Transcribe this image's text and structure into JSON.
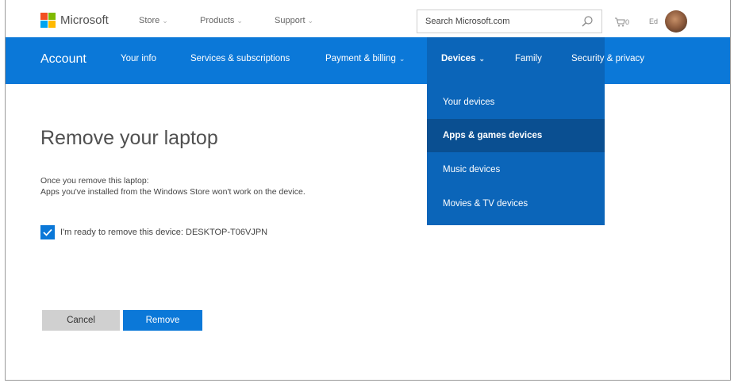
{
  "header": {
    "brand": "Microsoft",
    "nav": [
      {
        "label": "Store",
        "chevron": "⌄"
      },
      {
        "label": "Products",
        "chevron": "⌄"
      },
      {
        "label": "Support",
        "chevron": "⌄"
      }
    ],
    "search": {
      "placeholder": "Search Microsoft.com",
      "icon": "search-icon"
    },
    "cart": {
      "count": "0",
      "icon": "cart-icon"
    },
    "user_initials": "Ed"
  },
  "account_nav": {
    "account_label": "Account",
    "items": [
      {
        "label": "Your info"
      },
      {
        "label": "Services & subscriptions"
      },
      {
        "label": "Payment & billing",
        "chevron": "⌄"
      },
      {
        "label": "Devices",
        "chevron": "⌄",
        "active": true
      },
      {
        "label": "Family"
      },
      {
        "label": "Security & privacy"
      }
    ]
  },
  "devices_menu": {
    "items": [
      {
        "label": "Your devices"
      },
      {
        "label": "Apps & games devices",
        "highlighted": true
      },
      {
        "label": "Music devices"
      },
      {
        "label": "Movies & TV devices"
      }
    ]
  },
  "main": {
    "title": "Remove your laptop",
    "description_line1": "Once you remove this laptop:",
    "description_line2": "Apps you've installed from the Windows Store won't work on the device.",
    "checkbox_label": "I'm ready to remove this device: DESKTOP-T06VJPN",
    "checkbox_checked": true,
    "cancel_label": "Cancel",
    "remove_label": "Remove"
  },
  "colors": {
    "accent": "#0b78d8",
    "menu": "#0b65b9",
    "menu_highlight": "#0a4f91",
    "cancel_bg": "#d0d0d0"
  }
}
